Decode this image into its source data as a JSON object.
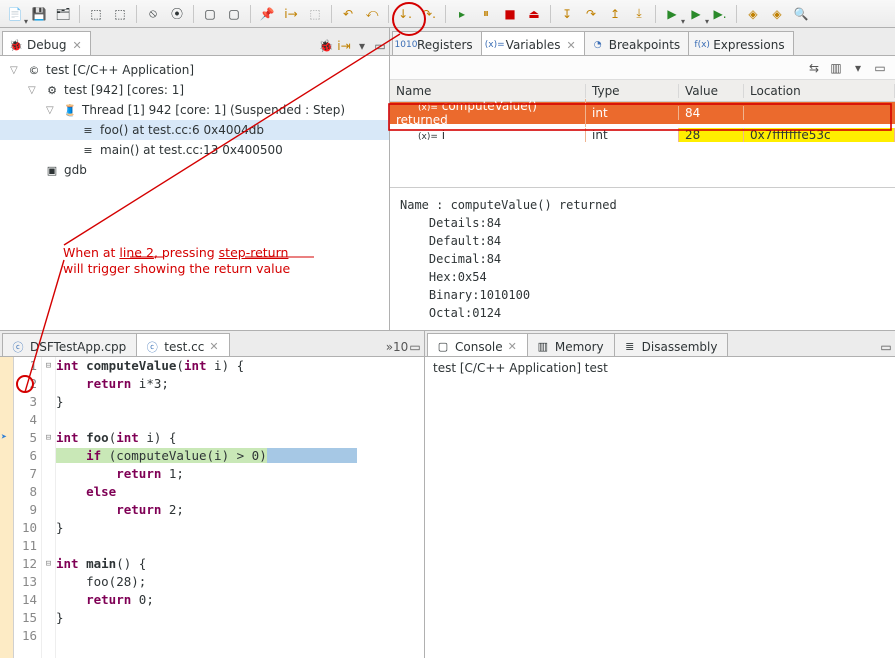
{
  "toolbar": {
    "buttons": [
      "new-drop",
      "save",
      "save-all",
      "|",
      "build",
      "build-all",
      "|",
      "toggle-bp",
      "skip-bp",
      "|",
      "mode-a",
      "mode-b",
      "|",
      "instr-step",
      "highlight",
      "|",
      "step-return",
      "undo",
      "|",
      "step-into-sel",
      "step-over-sel",
      "|",
      "resume",
      "pause",
      "stop",
      "disconnect",
      "|",
      "step-into",
      "step-over-alt",
      "step-return-alt",
      "drop-frame",
      "|",
      "run",
      "run-drop",
      "run-ext",
      "|",
      "debug-as",
      "profile",
      "search"
    ]
  },
  "debug_view": {
    "tab": "Debug",
    "tree": [
      {
        "indent": 0,
        "twisty": "▽",
        "icon": "©",
        "text": "test [C/C++ Application]"
      },
      {
        "indent": 1,
        "twisty": "▽",
        "icon": "⚙",
        "text": "test [942] [cores: 1]"
      },
      {
        "indent": 2,
        "twisty": "▽",
        "icon": "🧵",
        "text": "Thread [1] 942 [core: 1] (Suspended : Step)"
      },
      {
        "indent": 3,
        "twisty": "",
        "icon": "≡",
        "text": "foo() at test.cc:6 0x4004db",
        "selected": true
      },
      {
        "indent": 3,
        "twisty": "",
        "icon": "≡",
        "text": "main() at test.cc:13 0x400500"
      },
      {
        "indent": 1,
        "twisty": "",
        "icon": "▣",
        "text": "gdb"
      }
    ]
  },
  "right_tabs": [
    {
      "label": "Registers",
      "icon": "1010"
    },
    {
      "label": "Variables",
      "icon": "(x)=",
      "active": true
    },
    {
      "label": "Breakpoints",
      "icon": "◔"
    },
    {
      "label": "Expressions",
      "icon": "f(x)"
    }
  ],
  "var_cols": {
    "name": "Name",
    "type": "Type",
    "value": "Value",
    "location": "Location"
  },
  "var_rows": [
    {
      "name": "computeValue() returned",
      "type": "int",
      "value": "84",
      "location": "",
      "selected": true,
      "changed": false,
      "icon": "(x)="
    },
    {
      "name": "i",
      "type": "int",
      "value": "28",
      "location": "0x7fffffffe53c",
      "selected": false,
      "changed": true,
      "icon": "(x)="
    }
  ],
  "var_detail": "Name : computeValue() returned\n    Details:84\n    Default:84\n    Decimal:84\n    Hex:0x54\n    Binary:1010100\n    Octal:0124",
  "editor_tabs": [
    {
      "label": "DSFTestApp.cpp",
      "icon": "c",
      "active": false
    },
    {
      "label": "test.cc",
      "icon": "c",
      "active": true
    }
  ],
  "editor_more": "»10",
  "code": [
    {
      "n": 1,
      "fold": "⊟",
      "html": "<span class='kw'>int</span> <span class='fn'>computeValue</span>(<span class='kw'>int</span> i) {"
    },
    {
      "n": 2,
      "html": "    <span class='kw'>return</span> i*3;"
    },
    {
      "n": 3,
      "html": "}"
    },
    {
      "n": 4,
      "html": ""
    },
    {
      "n": 5,
      "fold": "⊟",
      "ann": "arrow",
      "html": "<span class='kw'>int</span> <span class='fn'>foo</span>(<span class='kw'>int</span> i) {"
    },
    {
      "n": 6,
      "current": true,
      "html": "    <span class='kw'>if</span> (computeValue(i) &gt; 0)"
    },
    {
      "n": 7,
      "html": "        <span class='kw'>return</span> 1;"
    },
    {
      "n": 8,
      "html": "    <span class='kw'>else</span>"
    },
    {
      "n": 9,
      "html": "        <span class='kw'>return</span> 2;"
    },
    {
      "n": 10,
      "html": "}"
    },
    {
      "n": 11,
      "html": ""
    },
    {
      "n": 12,
      "fold": "⊟",
      "html": "<span class='kw'>int</span> <span class='fn'>main</span>() {"
    },
    {
      "n": 13,
      "html": "    foo(28);"
    },
    {
      "n": 14,
      "html": "    <span class='kw'>return</span> 0;"
    },
    {
      "n": 15,
      "html": "}"
    },
    {
      "n": 16,
      "html": ""
    }
  ],
  "console_tabs": [
    {
      "label": "Console",
      "active": true,
      "icon": "▢"
    },
    {
      "label": "Memory",
      "icon": "▥"
    },
    {
      "label": "Disassembly",
      "icon": "≣"
    }
  ],
  "console_text": "test [C/C++ Application] test",
  "annotation": {
    "l1": "When at line 2, pressing step-return",
    "l2": "will trigger showing the return value",
    "u1": "line 2",
    "u2": "step-return"
  },
  "icons": {
    "save": "💾",
    "build": "🔨",
    "toggle-bp": "⦿",
    "skip-bp": "⤼",
    "step-return": "↩",
    "resume": "▸",
    "pause": "⏸",
    "stop": "■",
    "disconnect": "⏏",
    "step-into": "↧",
    "step-over-alt": "↷",
    "step-return-alt": "↥",
    "run": "▶",
    "debug": "🐞"
  }
}
